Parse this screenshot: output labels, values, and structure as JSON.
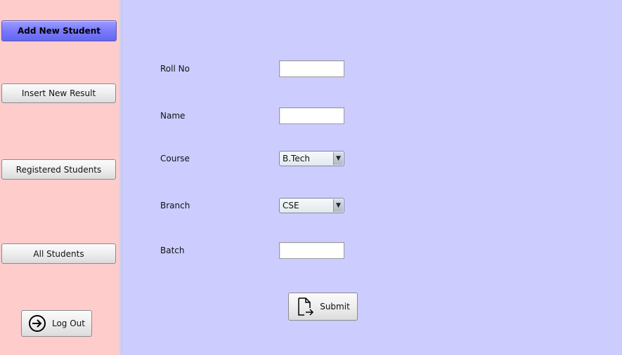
{
  "sidebar": {
    "add_new_student": "Add New Student",
    "insert_new_result": "Insert New Result",
    "registered_students": "Registered Students",
    "all_students": "All Students",
    "log_out": "Log Out"
  },
  "form": {
    "roll_no_label": "Roll No",
    "roll_no_value": "",
    "name_label": "Name",
    "name_value": "",
    "course_label": "Course",
    "course_value": "B.Tech",
    "branch_label": "Branch",
    "branch_value": "CSE",
    "batch_label": "Batch",
    "batch_value": "",
    "submit_label": "Submit"
  },
  "icons": {
    "logout": "logout-icon",
    "submit": "document-submit-icon",
    "dropdown": "chevron-down-icon"
  },
  "colors": {
    "sidebar_bg": "#ffcccc",
    "main_bg": "#ccccff",
    "active_button": "#7a7aff"
  }
}
